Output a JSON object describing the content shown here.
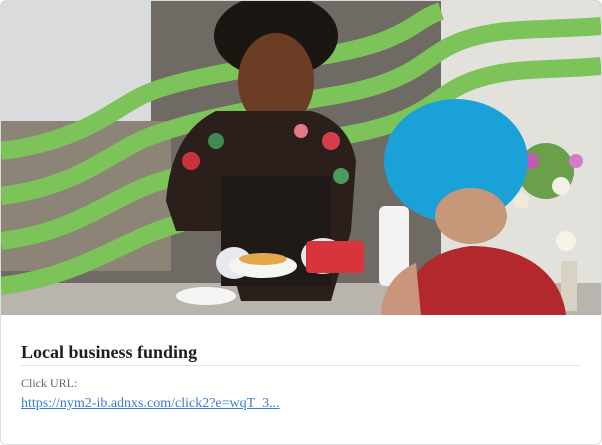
{
  "card": {
    "title": "Local business funding",
    "click_url_label": "Click URL:",
    "click_url_text": "https://nym2-ib.adnxs.com/click2?e=wqT_3..."
  },
  "image": {
    "description_icon": "photo-food-truck-vendor",
    "accent_color": "#7cc35a"
  }
}
